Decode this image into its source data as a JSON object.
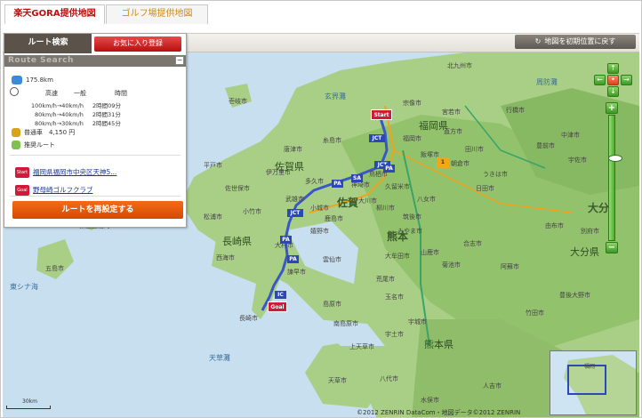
{
  "tabs": [
    {
      "label": "楽天GORA提供地図"
    },
    {
      "label": "ゴルフ場提供地図"
    }
  ],
  "panel": {
    "tab_route": "ルート検索",
    "tab_favorite": "お気に入り登録",
    "header": "Route Search",
    "distance": "175.8km",
    "speed_header": {
      "highway": "高速",
      "general": "一般",
      "time": "時間"
    },
    "speed_rows": [
      {
        "highway": "100km/h",
        "general": "40km/h",
        "time": "2時間09分"
      },
      {
        "highway": "80km/h",
        "general": "40km/h",
        "time": "2時間31分"
      },
      {
        "highway": "80km/h",
        "general": "30km/h",
        "time": "2時間45分"
      }
    ],
    "toll": "普通車　4,150 円",
    "route_type": "推奨ルート",
    "start_badge": "Start",
    "start": "福岡県福岡市中央区天神5...",
    "goal_badge": "Goal",
    "goal": "野母崎ゴルフクラブ",
    "reset_button": "ルートを再設定する"
  },
  "map_controls": {
    "init_button": "地図を初期位置に戻す",
    "zoom_in": "+",
    "zoom_out": "−",
    "zoom_level": 0.67
  },
  "map_labels": {
    "prefectures": [
      "福岡県",
      "佐賀県",
      "長崎県",
      "熊本県",
      "大分県",
      "佐賀",
      "熊本",
      "大分"
    ],
    "seas": [
      "玄界灘",
      "周防灘",
      "東シナ海",
      "天草灘"
    ],
    "cities": [
      "北九州市",
      "宗像市",
      "福岡市",
      "唐津市",
      "糸島市",
      "久留米市",
      "大牟田市",
      "島原市",
      "諫早市",
      "長崎市",
      "佐世保市",
      "平戸市",
      "伊万里市",
      "武雄市",
      "多久市",
      "鹿島市",
      "嬉野市",
      "柳川市",
      "大川市",
      "荒尾市",
      "玉名市",
      "山鹿市",
      "菊池市",
      "宇土市",
      "八代市",
      "天草市",
      "上天草市",
      "宇城市",
      "阿蘇市",
      "日田市",
      "中津市",
      "宇佐市",
      "豊後大野市",
      "竹田市",
      "由布市",
      "別府市",
      "五島市",
      "新上五島町",
      "雲仙市",
      "南島原市",
      "壱岐市",
      "飯塚市",
      "田川市",
      "行橋市",
      "豊前市",
      "直方市",
      "宮若市",
      "朝倉市",
      "うきは市",
      "八女市",
      "筑後市",
      "みやま市",
      "小城市",
      "神埼市",
      "鳥栖市",
      "西海市",
      "松浦市",
      "合志市",
      "人吉市",
      "水俣市",
      "大村市",
      "小竹市"
    ],
    "road_badges": [
      "JCT",
      "PA",
      "SA",
      "IC"
    ],
    "start_label": "Start",
    "goal_label": "Goal",
    "point_number": "1"
  },
  "scale": {
    "label": "30km"
  },
  "copyright": "©2012 ZENRIN DataCom・地図データ©2012 ZENRIN",
  "minimap": {
    "label": "福岡"
  },
  "colors": {
    "accent_red": "#b70f0f",
    "reset_orange": "#e85a0c",
    "route_blue": "#3a56c8",
    "map_green": "#8cc26e",
    "nav_green": "#4aae2c"
  }
}
